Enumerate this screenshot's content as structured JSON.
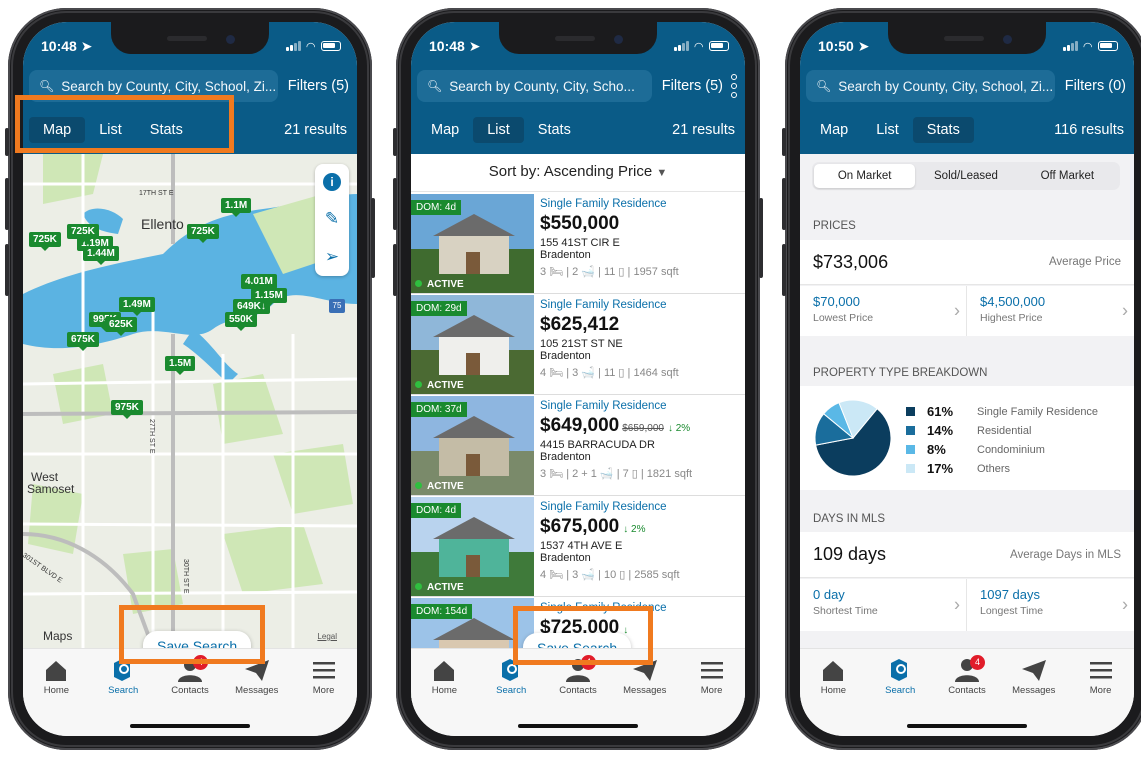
{
  "colors": {
    "header": "#0a5b87",
    "accent": "#0a6fa9",
    "pin": "#1a8a2f",
    "highlight": "#f07a1f",
    "badge": "#e11d2a"
  },
  "tabbar": {
    "items": [
      "Home",
      "Search",
      "Contacts",
      "Messages",
      "More"
    ],
    "contacts_badge": "4"
  },
  "phone1": {
    "time": "10:48",
    "search_placeholder": "Search by County, City, School, Zi...",
    "filters": "Filters (5)",
    "tabs": [
      "Map",
      "List",
      "Stats"
    ],
    "active_tab": "Map",
    "results": "21 results",
    "pins": [
      "1.1M",
      "725K",
      "725K",
      "1.19M",
      "1.44M",
      "725K",
      "4.01M",
      "1.15M",
      "649K↓",
      "1.49M",
      "995K",
      "625K",
      "550K",
      "675K",
      "1.5M",
      "975K"
    ],
    "street_17th": "17TH ST E",
    "place_ellenton": "Ellento",
    "place_west": "West",
    "place_samoset": "Samoset",
    "street_27th": "27TH ST E",
    "street_30th": "30TH ST E",
    "street_301": "301ST BLVD E",
    "highway": "75",
    "maps_logo": "Maps",
    "legal": "Legal",
    "save_search": "Save Search"
  },
  "phone2": {
    "time": "10:48",
    "search_placeholder": "Search by County, City, Scho...",
    "filters": "Filters (5)",
    "tabs": [
      "Map",
      "List",
      "Stats"
    ],
    "active_tab": "List",
    "results": "21 results",
    "sort_label": "Sort by: Ascending Price",
    "save_search": "Save Search",
    "listings": [
      {
        "dom": "DOM: 4d",
        "status": "ACTIVE",
        "type": "Single Family Residence",
        "price": "$550,000",
        "old": "",
        "chg": "",
        "addr": "155 41ST CIR E",
        "city": "Bradenton",
        "spec": "3 🛏 | 2 🛁 | 11 ▯ | 1957 sqft"
      },
      {
        "dom": "DOM: 29d",
        "status": "ACTIVE",
        "type": "Single Family Residence",
        "price": "$625,412",
        "old": "",
        "chg": "",
        "addr": "105 21ST ST NE",
        "city": "Bradenton",
        "spec": "4 🛏 | 3 🛁 | 11 ▯ | 1464 sqft"
      },
      {
        "dom": "DOM: 37d",
        "status": "ACTIVE",
        "type": "Single Family Residence",
        "price": "$649,000",
        "old": "$659,000",
        "chg": "↓ 2%",
        "addr": "4415 BARRACUDA DR",
        "city": "Bradenton",
        "spec": "3 🛏 | 2 + 1 🛁 | 7 ▯ | 1821 sqft"
      },
      {
        "dom": "DOM: 4d",
        "status": "ACTIVE",
        "type": "Single Family Residence",
        "price": "$675,000",
        "old": "",
        "chg": "↓ 2%",
        "addr": "1537 4TH AVE E",
        "city": "Bradenton",
        "spec": "4 🛏 | 3 🛁 | 10 ▯ | 2585 sqft"
      },
      {
        "dom": "DOM: 154d",
        "status": "",
        "type": "Single Family Residence",
        "price": "$725,000",
        "old": "",
        "chg": "↓",
        "addr": "T NE",
        "city": "",
        "spec": ""
      }
    ]
  },
  "phone3": {
    "time": "10:50",
    "search_placeholder": "Search by County, City, School, Zi...",
    "filters": "Filters (0)",
    "tabs": [
      "Map",
      "List",
      "Stats"
    ],
    "active_tab": "Stats",
    "results": "116 results",
    "segments": [
      "On Market",
      "Sold/Leased",
      "Off Market"
    ],
    "prices_head": "PRICES",
    "avg_price": "$733,006",
    "avg_price_caption": "Average Price",
    "lowest": "$70,000",
    "lowest_caption": "Lowest Price",
    "highest": "$4,500,000",
    "highest_caption": "Highest Price",
    "breakdown_head": "PROPERTY TYPE BREAKDOWN",
    "breakdown": [
      {
        "pct": "61%",
        "name": "Single Family Residence",
        "value": 61,
        "color": "#0b3d5e"
      },
      {
        "pct": "14%",
        "name": "Residential",
        "value": 14,
        "color": "#1a6d9c"
      },
      {
        "pct": "8%",
        "name": "Condominium",
        "value": 8,
        "color": "#5ab8e6"
      },
      {
        "pct": "17%",
        "name": "Others",
        "value": 17,
        "color": "#cbe8f6"
      }
    ],
    "dom_head": "DAYS IN MLS",
    "avg_days": "109 days",
    "avg_days_caption": "Average Days in MLS",
    "shortest": "0 day",
    "shortest_caption": "Shortest Time",
    "longest": "1097 days",
    "longest_caption": "Longest Time"
  }
}
